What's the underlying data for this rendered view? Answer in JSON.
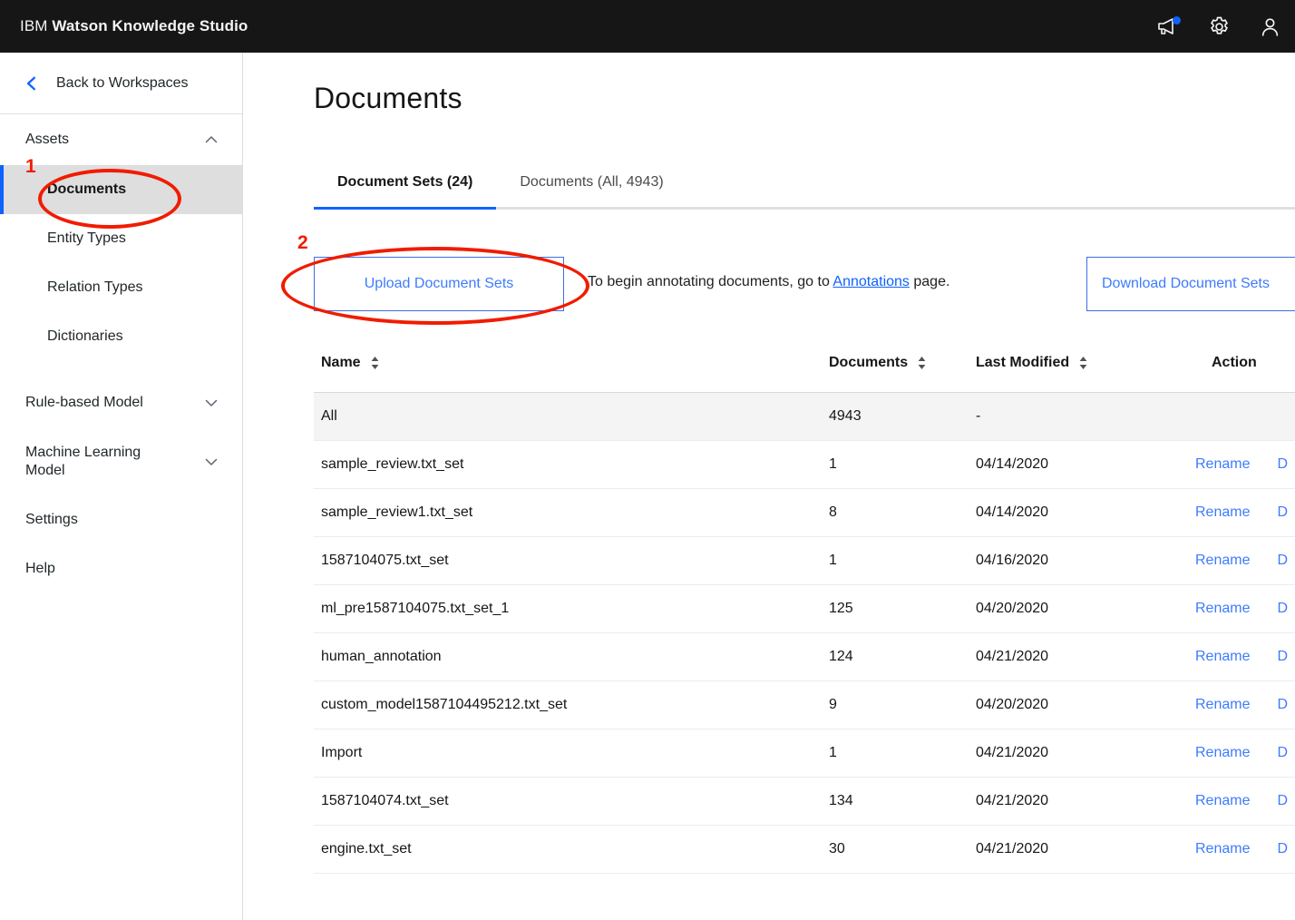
{
  "header": {
    "brand_prefix": "IBM",
    "brand_name": "Watson Knowledge Studio",
    "icons": {
      "announcement": "megaphone-icon",
      "settings": "gear-icon",
      "account": "user-avatar-icon"
    }
  },
  "sidebar": {
    "back_label": "Back to Workspaces",
    "groups": [
      {
        "label": "Assets",
        "expanded": true
      },
      {
        "label": "Rule-based Model",
        "expanded": false
      },
      {
        "label": "Machine Learning Model",
        "expanded": false
      }
    ],
    "assets_items": [
      {
        "label": "Documents",
        "selected": true
      },
      {
        "label": "Entity Types",
        "selected": false
      },
      {
        "label": "Relation Types",
        "selected": false
      },
      {
        "label": "Dictionaries",
        "selected": false
      }
    ],
    "bottom_items": [
      {
        "label": "Settings"
      },
      {
        "label": "Help"
      }
    ]
  },
  "main": {
    "page_title": "Documents",
    "tabs": [
      {
        "label": "Document Sets (24)",
        "active": true
      },
      {
        "label": "Documents (All, 4943)",
        "active": false
      }
    ],
    "actions": {
      "upload_label": "Upload Document Sets",
      "download_label": "Download Document Sets",
      "hint_before": "To begin annotating documents, go to ",
      "hint_link": "Annotations",
      "hint_after": " page."
    },
    "table": {
      "columns": [
        "Name",
        "Documents",
        "Last Modified",
        "Action"
      ],
      "action_labels": {
        "rename": "Rename",
        "delete": "D"
      },
      "rows": [
        {
          "name": "All",
          "documents": "4943",
          "modified": "-",
          "highlight": true,
          "actions": false
        },
        {
          "name": "sample_review.txt_set",
          "documents": "1",
          "modified": "04/14/2020",
          "highlight": false,
          "actions": true
        },
        {
          "name": "sample_review1.txt_set",
          "documents": "8",
          "modified": "04/14/2020",
          "highlight": false,
          "actions": true
        },
        {
          "name": "1587104075.txt_set",
          "documents": "1",
          "modified": "04/16/2020",
          "highlight": false,
          "actions": true
        },
        {
          "name": "ml_pre1587104075.txt_set_1",
          "documents": "125",
          "modified": "04/20/2020",
          "highlight": false,
          "actions": true
        },
        {
          "name": "human_annotation",
          "documents": "124",
          "modified": "04/21/2020",
          "highlight": false,
          "actions": true
        },
        {
          "name": "custom_model1587104495212.txt_set",
          "documents": "9",
          "modified": "04/20/2020",
          "highlight": false,
          "actions": true
        },
        {
          "name": "Import",
          "documents": "1",
          "modified": "04/21/2020",
          "highlight": false,
          "actions": true
        },
        {
          "name": "1587104074.txt_set",
          "documents": "134",
          "modified": "04/21/2020",
          "highlight": false,
          "actions": true
        },
        {
          "name": "engine.txt_set",
          "documents": "30",
          "modified": "04/21/2020",
          "highlight": false,
          "actions": true
        }
      ]
    }
  },
  "annotations": {
    "color": "#f01c00",
    "marks": [
      {
        "number": "1",
        "target": "sidebar-item-documents"
      },
      {
        "number": "2",
        "target": "upload-document-sets-button"
      }
    ]
  },
  "colors": {
    "header_bg": "#161616",
    "accent_blue": "#0f62fe",
    "link_blue": "#3d7bfd",
    "selected_nav_bg": "#dedede",
    "row_highlight_bg": "#f4f4f4",
    "annotation_red": "#f01c00"
  }
}
